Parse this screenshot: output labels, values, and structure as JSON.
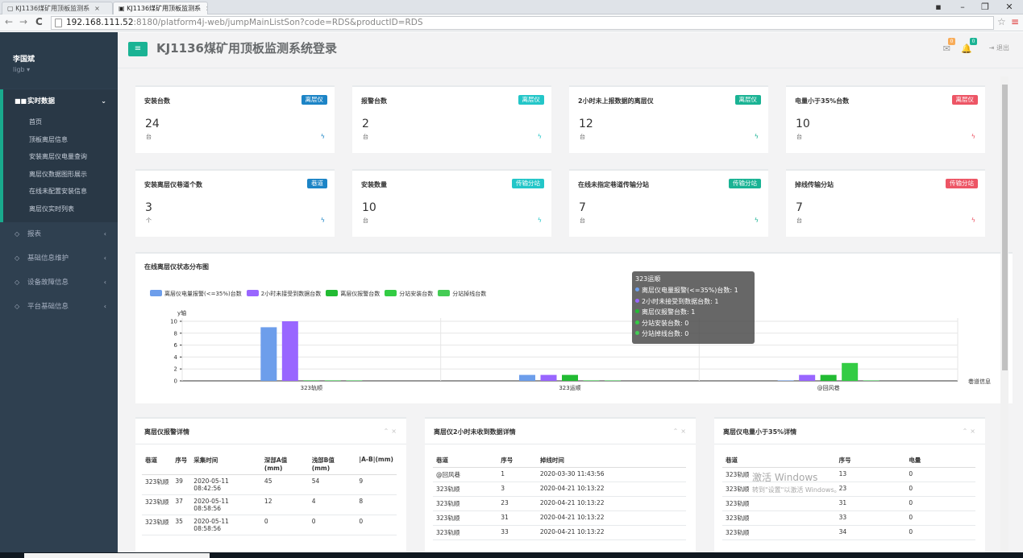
{
  "browser": {
    "tabs": [
      {
        "label": "KJ1136煤矿用顶板监测系"
      },
      {
        "label": "KJ1136煤矿用顶板监测系"
      }
    ],
    "url_host": "192.168.111.52",
    "url_rest": ":8180/platform4j-web/jumpMainListSon?code=RDS&productID=RDS"
  },
  "user": {
    "name": "李国斌",
    "login": "ligb ▾"
  },
  "sidebar": {
    "groups": [
      {
        "label": "实时数据",
        "items": [
          "首页",
          "顶板离层信息",
          "安装离层仪电量查询",
          "离层仪数据图形展示",
          "在线未配置安装信息",
          "离层仪实时列表"
        ]
      },
      {
        "label": "报表"
      },
      {
        "label": "基础信息维护"
      },
      {
        "label": "设备故障信息"
      },
      {
        "label": "平台基础信息"
      }
    ]
  },
  "header": {
    "title": "KJ1136煤矿用顶板监测系统登录",
    "mail_badge": "0",
    "bell_badge": "0",
    "logout": "退出"
  },
  "colors": {
    "accent": "#1ab394",
    "sidebar_bg": "#2f4050",
    "label_blue": "#1c84c6",
    "label_cyan": "#23c6c8",
    "label_green": "#1ab394",
    "label_red": "#ed5565"
  },
  "cards": [
    {
      "title": "安装台数",
      "label": "离层仪",
      "value": "24",
      "unit": "台",
      "color": "#1c84c6",
      "bolt": "#1c84c6"
    },
    {
      "title": "报警台数",
      "label": "离层仪",
      "value": "2",
      "unit": "台",
      "color": "#23c6c8",
      "bolt": "#23c6c8"
    },
    {
      "title": "2小时未上报数据的离层仪",
      "label": "离层仪",
      "value": "12",
      "unit": "台",
      "color": "#1ab394",
      "bolt": "#1ab394"
    },
    {
      "title": "电量小于35%台数",
      "label": "离层仪",
      "value": "10",
      "unit": "台",
      "color": "#ed5565",
      "bolt": "#ed5565"
    },
    {
      "title": "安装离层仪巷道个数",
      "label": "巷道",
      "value": "3",
      "unit": "个",
      "color": "#1c84c6",
      "bolt": "#1c84c6"
    },
    {
      "title": "安装数量",
      "label": "传输分站",
      "value": "10",
      "unit": "台",
      "color": "#23c6c8",
      "bolt": "#23c6c8"
    },
    {
      "title": "在线未指定巷道传输分站",
      "label": "传输分站",
      "value": "7",
      "unit": "台",
      "color": "#1ab394",
      "bolt": "#1ab394"
    },
    {
      "title": "掉线传输分站",
      "label": "传输分站",
      "value": "7",
      "unit": "台",
      "color": "#ed5565",
      "bolt": "#ed5565"
    }
  ],
  "chart": {
    "title": "在线离层仪状态分布图",
    "tooltip": {
      "header": "323运顺",
      "rows": [
        {
          "label": "离层仪电量报警(<=35%)台数: 1",
          "color": "#6d9eeb"
        },
        {
          "label": "2小时未接受到数据台数: 1",
          "color": "#9966ff"
        },
        {
          "label": "离层仪报警台数: 1",
          "color": "#22bb33"
        },
        {
          "label": "分站安装台数: 0",
          "color": "#33cc44"
        },
        {
          "label": "分站掉线台数: 0",
          "color": "#44cc55"
        }
      ]
    }
  },
  "chart_data": {
    "type": "bar",
    "title": "在线离层仪状态分布图",
    "ylabel": "y轴",
    "xlabel": "巷道信息",
    "ylim": [
      0,
      10
    ],
    "yticks": [
      0,
      2,
      4,
      6,
      8,
      10
    ],
    "grid": true,
    "legend_position": "top-left",
    "categories": [
      "323轨顺",
      "323运顺",
      "@回风巷"
    ],
    "series": [
      {
        "name": "离层仪电量报警(<=35%)台数",
        "color": "#6d9eeb",
        "values": [
          9,
          1,
          0
        ]
      },
      {
        "name": "2小时未接受到数据台数",
        "color": "#9966ff",
        "values": [
          10,
          1,
          1
        ]
      },
      {
        "name": "离层仪报警台数",
        "color": "#22bb33",
        "values": [
          0,
          1,
          1
        ]
      },
      {
        "name": "分站安装台数",
        "color": "#33cc44",
        "values": [
          0,
          0,
          3
        ]
      },
      {
        "name": "分站掉线台数",
        "color": "#44cc55",
        "values": [
          0,
          0,
          0
        ]
      }
    ]
  },
  "panels": {
    "alarm": {
      "title": "离层仪报警详情",
      "headers": [
        "巷道",
        "序号",
        "采集时间",
        "深部A值(mm)",
        "浅部B值(mm)",
        "|A-B|(mm)"
      ],
      "rows": [
        [
          "323轨顺",
          "39",
          "2020-05-11 08:42:56",
          "45",
          "54",
          "9"
        ],
        [
          "323轨顺",
          "37",
          "2020-05-11 08:58:56",
          "12",
          "4",
          "8"
        ],
        [
          "323轨顺",
          "35",
          "2020-05-11 08:58:56",
          "0",
          "0",
          "0"
        ]
      ]
    },
    "nodata": {
      "title": "离层仪2小时未收到数据详情",
      "headers": [
        "巷道",
        "序号",
        "掉线时间"
      ],
      "rows": [
        [
          "@回风巷",
          "1",
          "2020-03-30 11:43:56"
        ],
        [
          "323轨顺",
          "3",
          "2020-04-21 10:13:22"
        ],
        [
          "323轨顺",
          "23",
          "2020-04-21 10:13:22"
        ],
        [
          "323轨顺",
          "31",
          "2020-04-21 10:13:22"
        ],
        [
          "323轨顺",
          "33",
          "2020-04-21 10:13:22"
        ]
      ]
    },
    "battery": {
      "title": "离层仪电量小于35%详情",
      "headers": [
        "巷道",
        "序号",
        "电量"
      ],
      "rows": [
        [
          "323轨顺",
          "13",
          "0"
        ],
        [
          "323轨顺",
          "23",
          "0"
        ],
        [
          "323轨顺",
          "31",
          "0"
        ],
        [
          "323轨顺",
          "33",
          "0"
        ],
        [
          "323轨顺",
          "34",
          "0"
        ]
      ]
    }
  },
  "watermark": {
    "line1": "激活 Windows",
    "line2": "转到\"设置\"以激活 Windows。"
  }
}
